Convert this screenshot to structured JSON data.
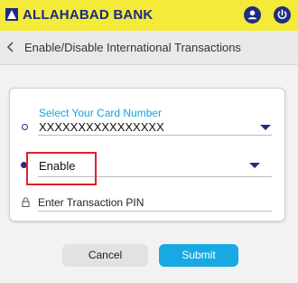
{
  "header": {
    "bank_name": "ALLAHABAD BANK",
    "brand_color": "#f4ea3a",
    "accent_color": "#1f2e80",
    "icons": [
      "user-icon",
      "power-icon"
    ]
  },
  "subheader": {
    "back_icon": "chevron-left-icon",
    "title": "Enable/Disable International Transactions"
  },
  "form": {
    "card_select": {
      "label": "Select Your Card Number",
      "value": "XXXXXXXXXXXXXXXX"
    },
    "action_select": {
      "value": "Enable"
    },
    "pin": {
      "placeholder": "Enter Transaction PIN",
      "value": ""
    }
  },
  "buttons": {
    "cancel": "Cancel",
    "submit": "Submit",
    "submit_color": "#18a9e3"
  }
}
